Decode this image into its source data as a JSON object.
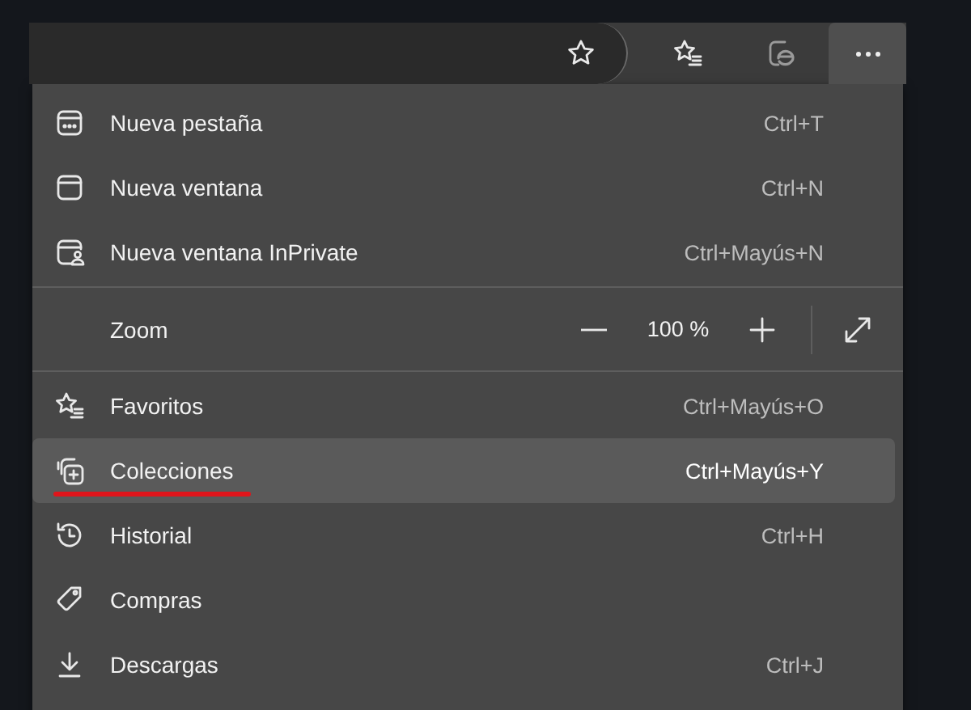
{
  "toolbar": {
    "buttons": [
      {
        "kind": "favorites",
        "selected": false
      },
      {
        "kind": "ie",
        "selected": false
      },
      {
        "kind": "more",
        "selected": true
      }
    ]
  },
  "menu": {
    "items": [
      {
        "kind": "item",
        "label": "Nueva pestaña",
        "shortcut": "Ctrl+T",
        "selected": false,
        "underlined": false
      },
      {
        "kind": "item",
        "label": "Nueva ventana",
        "shortcut": "Ctrl+N",
        "selected": false,
        "underlined": false
      },
      {
        "kind": "item",
        "label": "Nueva ventana InPrivate",
        "shortcut": "Ctrl+Mayús+N",
        "selected": false,
        "underlined": false
      },
      {
        "kind": "separator"
      },
      {
        "kind": "zoom",
        "label": "Zoom",
        "value": "100 %"
      },
      {
        "kind": "separator"
      },
      {
        "kind": "item",
        "label": "Favoritos",
        "shortcut": "Ctrl+Mayús+O",
        "selected": false,
        "underlined": false
      },
      {
        "kind": "item",
        "label": "Colecciones",
        "shortcut": "Ctrl+Mayús+Y",
        "selected": true,
        "underlined": true
      },
      {
        "kind": "item",
        "label": "Historial",
        "shortcut": "Ctrl+H",
        "selected": false,
        "underlined": false
      },
      {
        "kind": "item",
        "label": "Compras",
        "selected": false,
        "underlined": false
      },
      {
        "kind": "item",
        "label": "Descargas",
        "shortcut": "Ctrl+J",
        "selected": false,
        "underlined": false
      }
    ]
  }
}
